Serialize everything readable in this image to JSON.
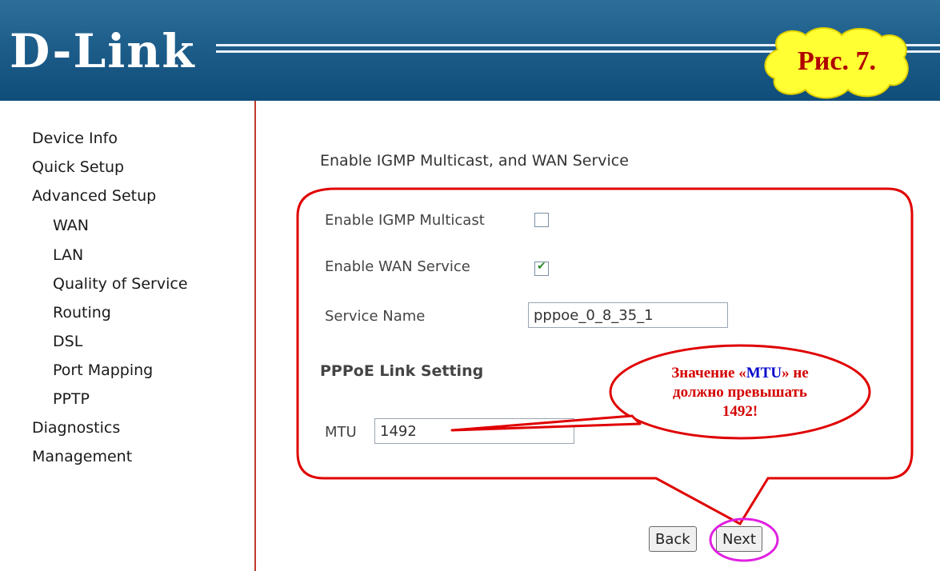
{
  "brand": "D-Link",
  "figure_label": "Рис. 7.",
  "sidebar": {
    "items": [
      {
        "label": "Device Info",
        "sub": false
      },
      {
        "label": "Quick Setup",
        "sub": false
      },
      {
        "label": "Advanced Setup",
        "sub": false
      },
      {
        "label": "WAN",
        "sub": true
      },
      {
        "label": "LAN",
        "sub": true
      },
      {
        "label": "Quality of Service",
        "sub": true
      },
      {
        "label": "Routing",
        "sub": true
      },
      {
        "label": "DSL",
        "sub": true
      },
      {
        "label": "Port Mapping",
        "sub": true
      },
      {
        "label": "PPTP",
        "sub": true
      },
      {
        "label": "Diagnostics",
        "sub": false
      },
      {
        "label": "Management",
        "sub": false
      }
    ]
  },
  "main": {
    "title": "Enable IGMP Multicast, and WAN Service",
    "igmp_label": "Enable IGMP Multicast",
    "igmp_checked": false,
    "wan_label": "Enable WAN Service",
    "wan_checked": true,
    "service_name_label": "Service Name",
    "service_name_value": "pppoe_0_8_35_1",
    "pppoe_title": "PPPoE Link Setting",
    "mtu_label": "MTU",
    "mtu_value": "1492",
    "back_label": "Back",
    "next_label": "Next"
  },
  "callout": {
    "prefix": "Значение «",
    "mtu": "MTU",
    "suffix": "» не",
    "line2": "должно превышать",
    "line3": "1492!"
  },
  "colors": {
    "header_blue": "#1f5f8c",
    "annotation_red": "#e00000",
    "highlight_magenta": "#e020e0",
    "cloud_yellow": "#ffff33"
  }
}
